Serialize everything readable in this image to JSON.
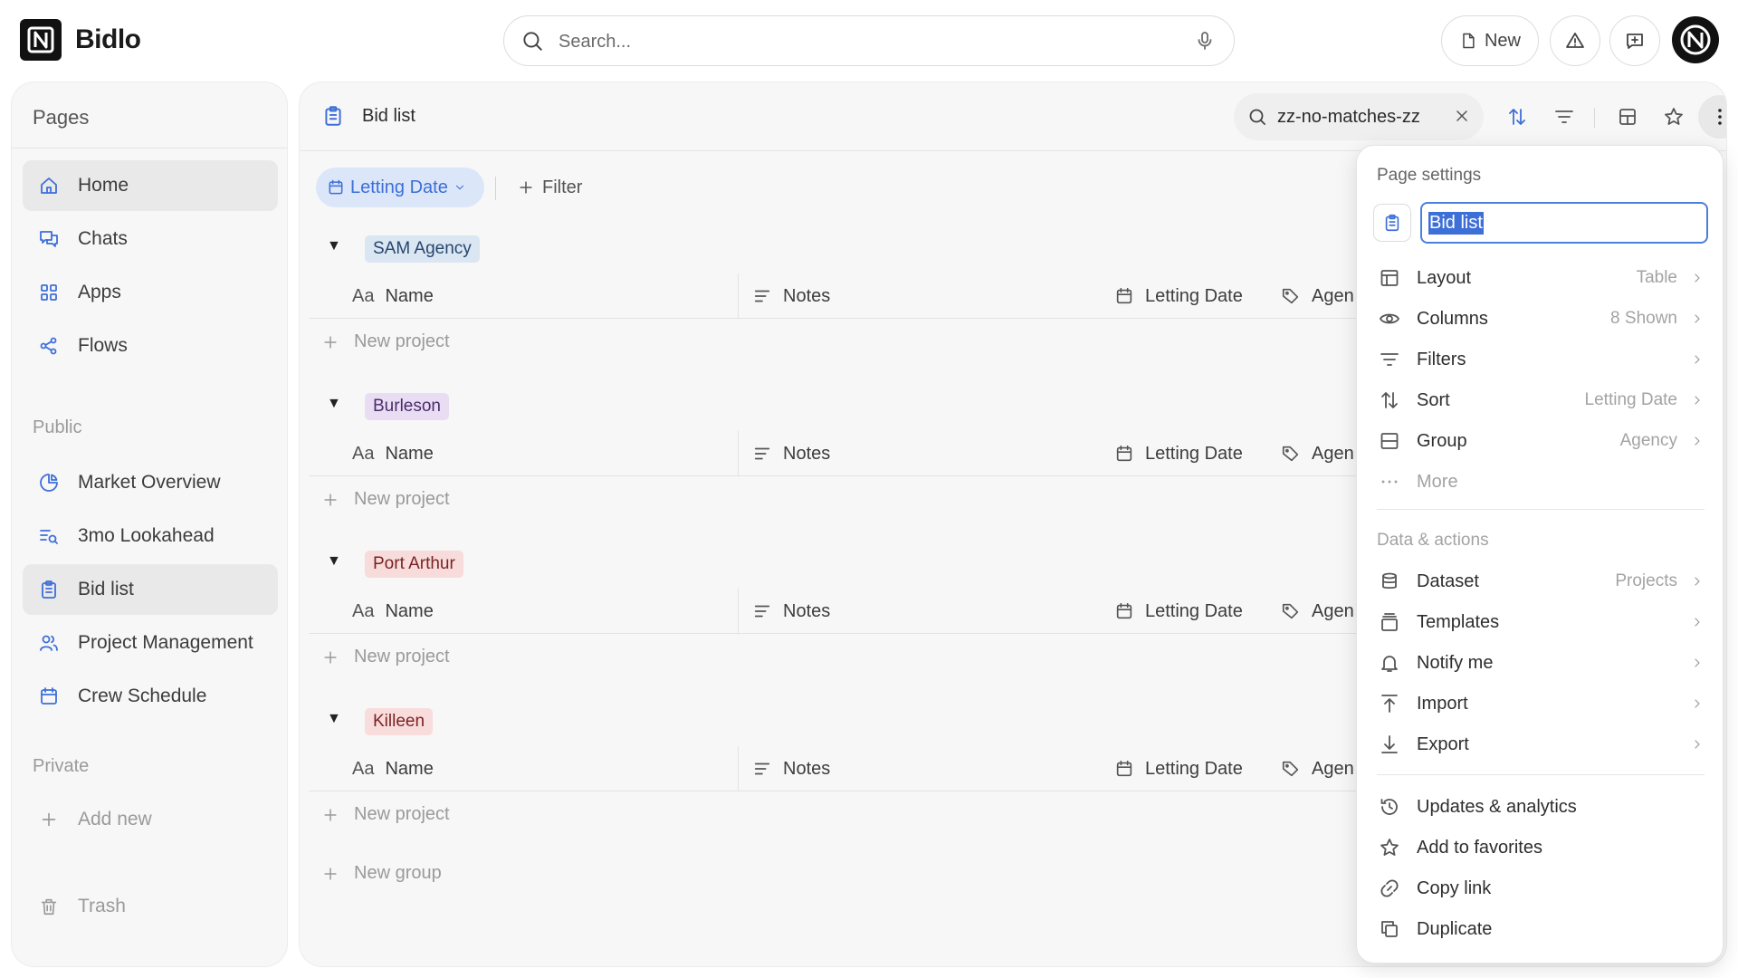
{
  "app": {
    "brand": "Bidlo"
  },
  "search": {
    "placeholder": "Search..."
  },
  "topbar": {
    "new_label": "New"
  },
  "sidebar": {
    "title": "Pages",
    "main_items": [
      {
        "label": "Home",
        "icon": "home-icon"
      },
      {
        "label": "Chats",
        "icon": "chats-icon"
      },
      {
        "label": "Apps",
        "icon": "apps-icon"
      },
      {
        "label": "Flows",
        "icon": "flows-icon"
      }
    ],
    "public_title": "Public",
    "public_items": [
      {
        "label": "Market Overview",
        "icon": "pie-chart-icon"
      },
      {
        "label": "3mo Lookahead",
        "icon": "list-search-icon"
      },
      {
        "label": "Bid list",
        "icon": "clipboard-icon"
      },
      {
        "label": "Project Management",
        "icon": "users-icon"
      },
      {
        "label": "Crew Schedule",
        "icon": "calendar-icon"
      }
    ],
    "private_title": "Private",
    "add_new": "Add new",
    "trash": "Trash",
    "active_item": "Bid list"
  },
  "page": {
    "title": "Bid list",
    "search_query": "zz-no-matches-zz",
    "group_chip": "Letting Date",
    "filter_label": "Filter",
    "columns": {
      "name": "Name",
      "name_prefix": "Aa",
      "notes": "Notes",
      "letting_date": "Letting Date",
      "agency": "Agen"
    },
    "groups": [
      {
        "label": "SAM Agency",
        "bg": "#dbe6f3",
        "fg": "#26466e"
      },
      {
        "label": "Burleson",
        "bg": "#e9ddf3",
        "fg": "#4b2d6b"
      },
      {
        "label": "Port Arthur",
        "bg": "#f8dcdc",
        "fg": "#7a2323"
      },
      {
        "label": "Killeen",
        "bg": "#f9dcdc",
        "fg": "#7a2323"
      }
    ],
    "new_project": "New project",
    "new_group": "New group"
  },
  "settings_menu": {
    "title": "Page settings",
    "name_value": "Bid list",
    "items": [
      {
        "label": "Layout",
        "value": "Table",
        "icon": "layout-icon"
      },
      {
        "label": "Columns",
        "value": "8 Shown",
        "icon": "eye-icon"
      },
      {
        "label": "Filters",
        "value": "",
        "icon": "filter-icon"
      },
      {
        "label": "Sort",
        "value": "Letting Date",
        "icon": "sort-icon"
      },
      {
        "label": "Group",
        "value": "Agency",
        "icon": "group-icon"
      },
      {
        "label": "More",
        "value": "",
        "icon": "more-dots-icon"
      }
    ],
    "data_title": "Data & actions",
    "data_items": [
      {
        "label": "Dataset",
        "value": "Projects",
        "icon": "database-icon"
      },
      {
        "label": "Templates",
        "value": "",
        "icon": "templates-icon"
      },
      {
        "label": "Notify me",
        "value": "",
        "icon": "bell-icon"
      },
      {
        "label": "Import",
        "value": "",
        "icon": "import-icon"
      },
      {
        "label": "Export",
        "value": "",
        "icon": "export-icon"
      }
    ],
    "action_items": [
      {
        "label": "Updates & analytics",
        "icon": "history-icon"
      },
      {
        "label": "Add to favorites",
        "icon": "star-icon"
      },
      {
        "label": "Copy link",
        "icon": "link-icon"
      },
      {
        "label": "Duplicate",
        "icon": "duplicate-icon"
      }
    ]
  },
  "colors": {
    "accent": "#3d6fd8",
    "panel_bg": "#f7f7f7",
    "selection": "#3d6fd8"
  }
}
